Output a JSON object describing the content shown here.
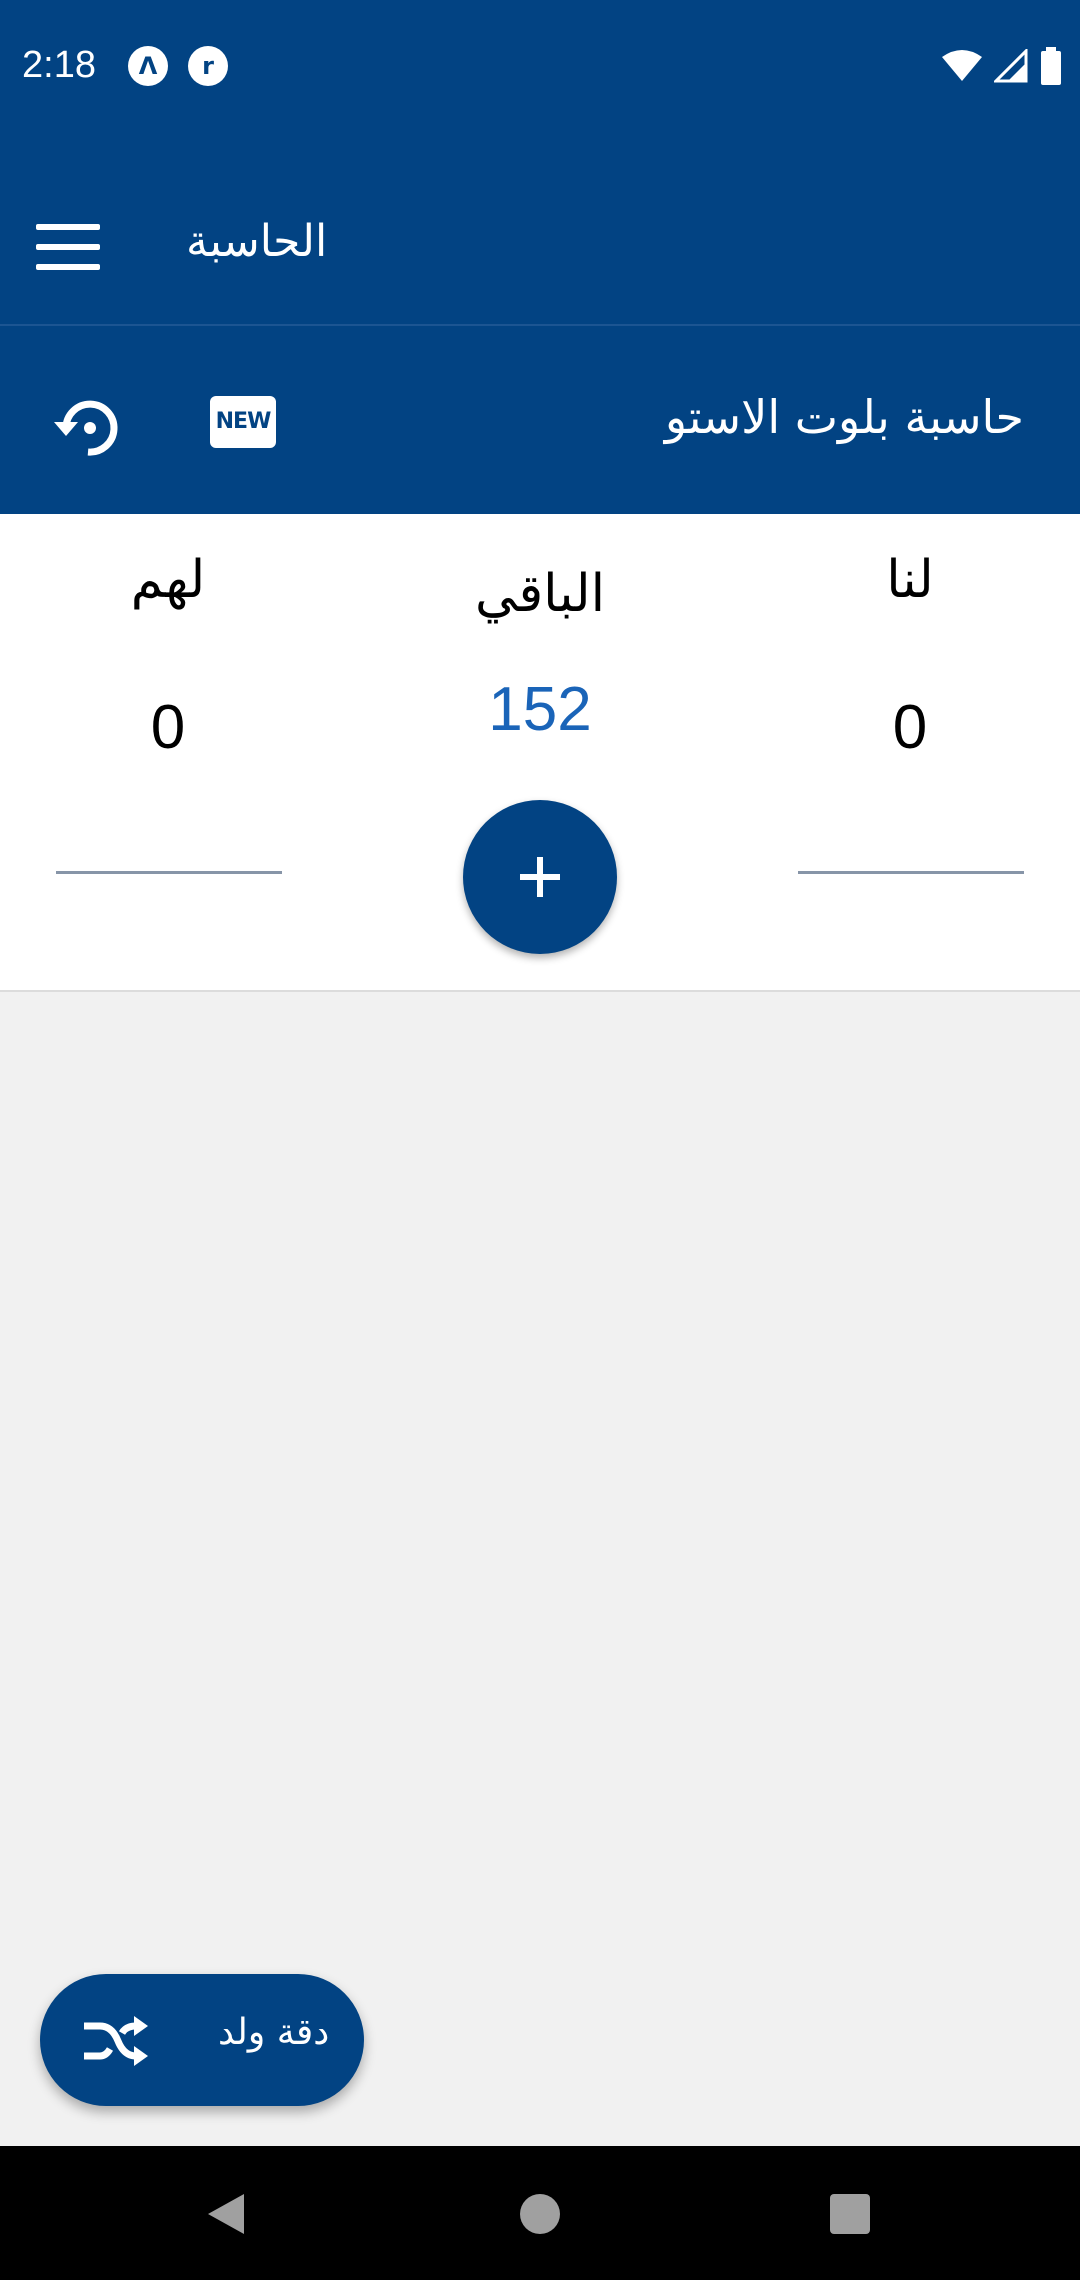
{
  "status_bar": {
    "time": "2:18",
    "icons_left": [
      "notification-a-icon",
      "notification-r-icon"
    ],
    "icons_right": [
      "wifi-icon",
      "cell-signal-icon",
      "battery-icon"
    ]
  },
  "app_bar": {
    "title": "الحاسبة",
    "menu_icon": "hamburger-menu-icon"
  },
  "sub_bar": {
    "title": "حاسبة بلوت الاستو",
    "new_label": "NEW",
    "history_icon": "history-reset-icon"
  },
  "score": {
    "us_label": "لنا",
    "remaining_label": "الباقي",
    "them_label": "لهم",
    "us_value": "0",
    "remaining_value": "152",
    "them_value": "0",
    "us_input_value": "",
    "them_input_value": "",
    "add_icon": "plus-icon"
  },
  "fab": {
    "label": "دقة ولد",
    "icon": "shuffle-icon"
  },
  "colors": {
    "primary": "#024383",
    "accent": "#1a64b8",
    "background": "#f1f1f1"
  }
}
